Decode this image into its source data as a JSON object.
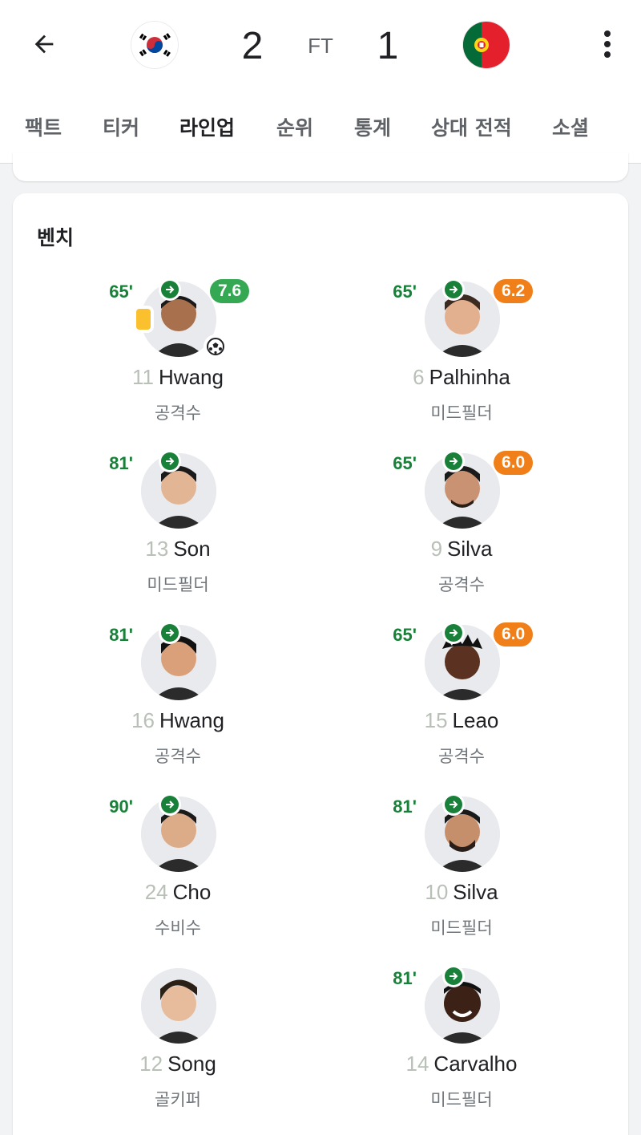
{
  "match": {
    "home_score": "2",
    "away_score": "1",
    "status": "FT",
    "home_team": "South Korea",
    "away_team": "Portugal",
    "colors": {
      "accent": "#188038",
      "rating_high": "#34a853",
      "rating_mid": "#f07f1a"
    }
  },
  "tabs": [
    {
      "label": "팩트"
    },
    {
      "label": "티커"
    },
    {
      "label": "라인업"
    },
    {
      "label": "순위"
    },
    {
      "label": "통계"
    },
    {
      "label": "상대 전적"
    },
    {
      "label": "소셜"
    }
  ],
  "active_tab": "라인업",
  "bench": {
    "title": "벤치",
    "home": [
      {
        "minute": "65'",
        "rating": "7.6",
        "rating_color": "green",
        "yellow_card": true,
        "goal": true,
        "number": "11",
        "name": "Hwang",
        "position": "공격수"
      },
      {
        "minute": "81'",
        "rating": "",
        "number": "13",
        "name": "Son",
        "position": "미드필더"
      },
      {
        "minute": "81'",
        "rating": "",
        "number": "16",
        "name": "Hwang",
        "position": "공격수"
      },
      {
        "minute": "90'",
        "rating": "",
        "number": "24",
        "name": "Cho",
        "position": "수비수"
      },
      {
        "minute": "",
        "rating": "",
        "number": "12",
        "name": "Song",
        "position": "골키퍼"
      }
    ],
    "away": [
      {
        "minute": "65'",
        "rating": "6.2",
        "rating_color": "orange",
        "number": "6",
        "name": "Palhinha",
        "position": "미드필더"
      },
      {
        "minute": "65'",
        "rating": "6.0",
        "rating_color": "orange",
        "number": "9",
        "name": "Silva",
        "position": "공격수"
      },
      {
        "minute": "65'",
        "rating": "6.0",
        "rating_color": "orange",
        "number": "15",
        "name": "Leao",
        "position": "공격수"
      },
      {
        "minute": "81'",
        "rating": "",
        "number": "10",
        "name": "Silva",
        "position": "미드필더"
      },
      {
        "minute": "81'",
        "rating": "",
        "number": "14",
        "name": "Carvalho",
        "position": "미드필더"
      }
    ]
  }
}
